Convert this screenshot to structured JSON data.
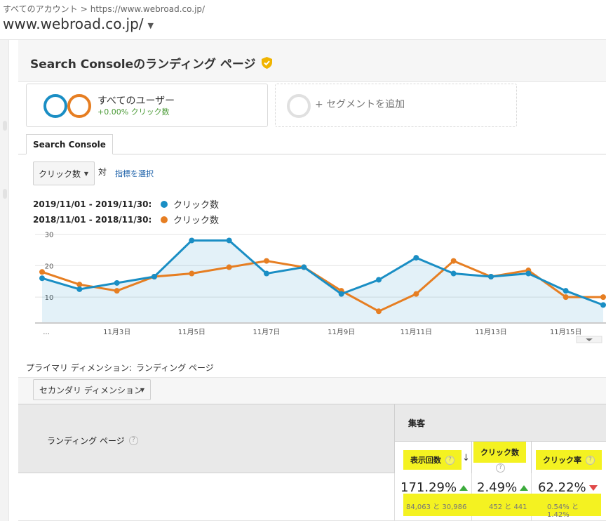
{
  "header": {
    "breadcrumb_account": "すべてのアカウント",
    "breadcrumb_sep": ">",
    "breadcrumb_url": "https://www.webroad.co.jp/",
    "property": "www.webroad.co.jp/"
  },
  "report": {
    "title": "Search Consoleのランディング ページ"
  },
  "segments": {
    "active_name": "すべてのユーザー",
    "active_sub": "+0.00% クリック数",
    "add_label": "+ セグメントを追加"
  },
  "tab": "Search Console",
  "metric_selector": {
    "selected": "クリック数",
    "vs": "対",
    "pick_metric": "指標を選択"
  },
  "legend": [
    {
      "range": "2019/11/01 - 2019/11/30:",
      "label": "クリック数",
      "color": "#1a8ec4"
    },
    {
      "range": "2018/11/01 - 2018/11/30:",
      "label": "クリック数",
      "color": "#e67e22"
    }
  ],
  "chart_data": {
    "type": "line",
    "x": [
      "11月1日",
      "11月2日",
      "11月3日",
      "11月4日",
      "11月5日",
      "11月6日",
      "11月7日",
      "11月8日",
      "11月9日",
      "11月10日",
      "11月11日",
      "11月12日",
      "11月13日",
      "11月14日",
      "11月15日",
      "11月16日"
    ],
    "x_tick_labels": [
      "...",
      "11月3日",
      "11月5日",
      "11月7日",
      "11月9日",
      "11月11日",
      "11月13日",
      "11月15日"
    ],
    "y_ticks": [
      10,
      20,
      30
    ],
    "ylim": [
      2,
      31
    ],
    "grid": true,
    "series": [
      {
        "name": "2019/11/01 - 2019/11/30",
        "color": "#1a8ec4",
        "area": true,
        "values": [
          16,
          12.5,
          14.5,
          16.5,
          28,
          28,
          17.5,
          19.5,
          11,
          15.5,
          22.5,
          17.5,
          16.5,
          17.5,
          12,
          7.5
        ]
      },
      {
        "name": "2018/11/01 - 2018/11/30",
        "color": "#e67e22",
        "area": false,
        "values": [
          18,
          14,
          12,
          16.5,
          17.5,
          19.5,
          21.5,
          19.5,
          12,
          5.5,
          11,
          21.5,
          16.5,
          18.5,
          10,
          10
        ]
      }
    ]
  },
  "dimension": {
    "primary_label": "プライマリ ディメンション:",
    "primary_value": "ランディング ページ",
    "secondary_button": "セカンダリ ディメンション"
  },
  "table": {
    "col_landing": "ランディング ページ",
    "group": "集客",
    "cols": [
      "表示回数",
      "クリック数",
      "クリック率"
    ],
    "sort_arrow": "↓",
    "q": "?",
    "values": [
      "171.29%",
      "2.49%",
      "62.22%"
    ],
    "comparisons": [
      "84,063 と 30,986",
      "452 と 441",
      "0.54% と 1.42%"
    ]
  },
  "colors": {
    "blue": "#1a8ec4",
    "orange": "#e67e22",
    "highlight": "#f4f221",
    "up": "#3cab3c",
    "down": "#e04848"
  }
}
